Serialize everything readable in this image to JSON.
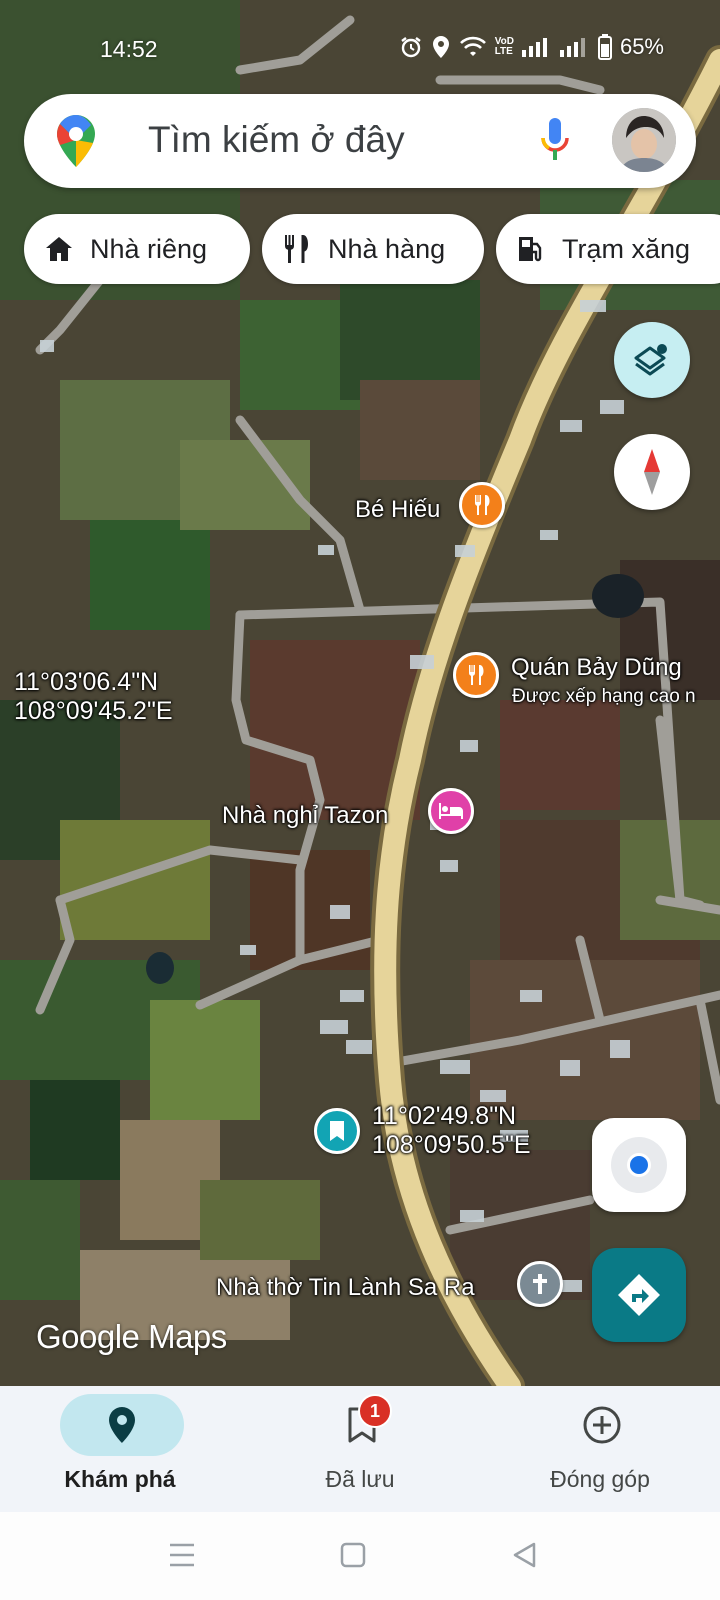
{
  "status_bar": {
    "time": "14:52",
    "battery": "65%",
    "network_label_top": "VoD",
    "network_label_bottom": "LTE",
    "icons": [
      "alarm-icon",
      "location-icon",
      "wifi-icon",
      "signal-icon",
      "battery-icon"
    ]
  },
  "search": {
    "placeholder": "Tìm kiếm ở đây",
    "icons": [
      "maps-pin-logo",
      "mic-icon",
      "avatar"
    ]
  },
  "chips": [
    {
      "label": "Nhà riêng",
      "icon": "home-icon"
    },
    {
      "label": "Nhà hàng",
      "icon": "restaurant-icon"
    },
    {
      "label": "Trạm xăng",
      "icon": "gas-station-icon"
    }
  ],
  "map": {
    "places": [
      {
        "name": "Bé Hiếu",
        "type": "restaurant"
      },
      {
        "name": "Quán Bảy Dũng",
        "subtitle": "Được xếp hạng cao n",
        "type": "restaurant"
      },
      {
        "name": "Nhà nghỉ Tazon",
        "type": "hotel"
      },
      {
        "name": "Nhà thờ Tin Lành Sa Ra",
        "type": "church"
      }
    ],
    "coordinates": [
      {
        "lat": "11°03'06.4\"N",
        "lng": "108°09'45.2\"E"
      },
      {
        "lat": "11°02'49.8\"N",
        "lng": "108°09'50.5\"E"
      }
    ],
    "watermark": "Google Maps",
    "colors": {
      "road_main": "#e6d49a",
      "road_minor": "#9a9a96",
      "pin_restaurant": "#f3801a",
      "pin_hotel": "#e040a8",
      "pin_saved": "#12a4b4"
    }
  },
  "controls": {
    "icons": [
      "layers-icon",
      "compass-icon",
      "my-location-icon",
      "directions-icon"
    ]
  },
  "bottom_nav": {
    "items": [
      {
        "label": "Khám phá",
        "icon": "explore-pin-icon",
        "active": true
      },
      {
        "label": "Đã lưu",
        "icon": "bookmark-icon",
        "badge": "1"
      },
      {
        "label": "Đóng góp",
        "icon": "add-circle-icon"
      }
    ]
  },
  "system_nav": {
    "icons": [
      "menu-icon",
      "home-square-icon",
      "back-icon"
    ]
  }
}
